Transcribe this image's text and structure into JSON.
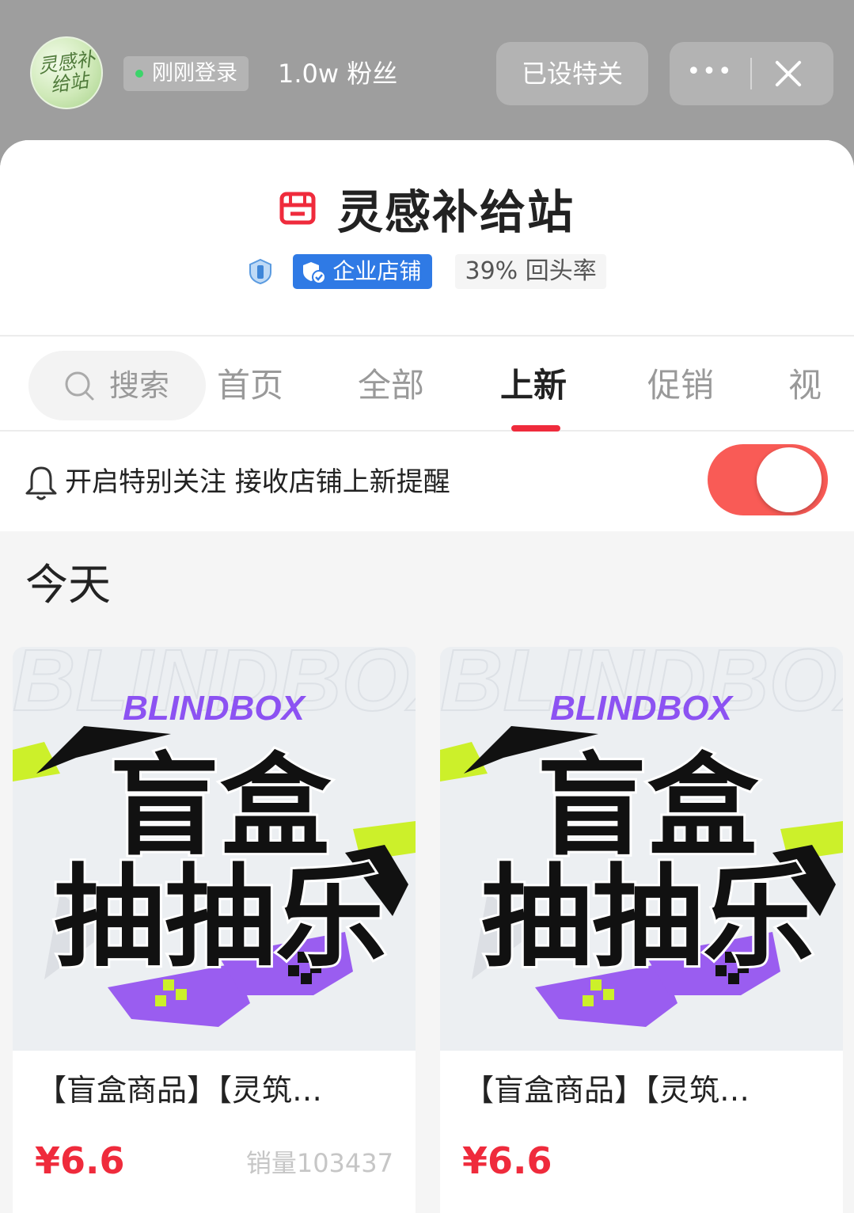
{
  "header": {
    "avatar_text": "灵感补给站",
    "login_status": "刚刚登录",
    "fans": "1.0w 粉丝",
    "special_follow_label": "已设特关",
    "more_icon": "•••",
    "close_icon": "close-icon"
  },
  "store": {
    "name": "灵感补给站",
    "enterprise_badge": "企业店铺",
    "return_rate": "39% 回头率"
  },
  "tabs": {
    "search_label": "搜索",
    "items": [
      "首页",
      "全部",
      "上新",
      "促销",
      "视频"
    ],
    "active": "上新"
  },
  "notify": {
    "text": "开启特别关注 接收店铺上新提醒",
    "toggle_on": true
  },
  "section": {
    "title": "今天"
  },
  "products": [
    {
      "image_top_text": "BLINDBOX",
      "image_line1": "盲盒",
      "image_line2": "抽抽乐",
      "title": "【盲盒商品】【灵筑…",
      "price": "¥6.6",
      "sales": "销量103437"
    },
    {
      "image_top_text": "BLINDBOX",
      "image_line1": "盲盒",
      "image_line2": "抽抽乐",
      "title": "【盲盒商品】【灵筑…",
      "price": "¥6.6",
      "sales": ""
    }
  ],
  "colors": {
    "accent": "#ef2b3c",
    "toggle": "#f95b56",
    "enterprise_blue": "#2f7ae5",
    "top_gray": "#9e9e9e"
  }
}
